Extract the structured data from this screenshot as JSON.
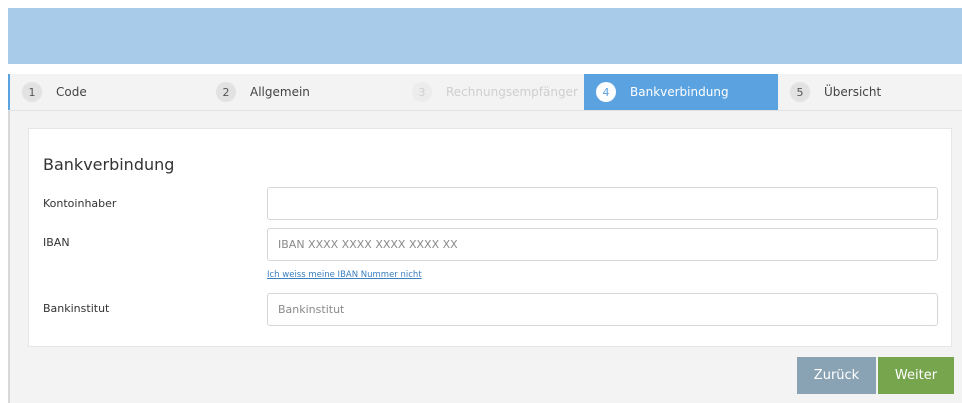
{
  "steps": [
    {
      "number": "1",
      "label": "Code",
      "state": "done"
    },
    {
      "number": "2",
      "label": "Allgemein",
      "state": "done"
    },
    {
      "number": "3",
      "label": "Rechnungsempfänger",
      "state": "disabled"
    },
    {
      "number": "4",
      "label": "Bankverbindung",
      "state": "active"
    },
    {
      "number": "5",
      "label": "Übersicht",
      "state": "pending"
    }
  ],
  "form": {
    "title": "Bankverbindung",
    "account_holder": {
      "label": "Kontoinhaber",
      "value": "",
      "placeholder": ""
    },
    "iban": {
      "label": "IBAN",
      "value": "",
      "placeholder": "IBAN XXXX XXXX XXXX XXXX XX"
    },
    "iban_help_link": "Ich weiss meine IBAN Nummer nicht",
    "bank": {
      "label": "Bankinstitut",
      "value": "",
      "placeholder": "Bankinstitut"
    }
  },
  "buttons": {
    "back": "Zurück",
    "next": "Weiter"
  },
  "colors": {
    "banner": "#a9cbea",
    "active_step": "#5aa2e0",
    "back_button": "#8aa3b4",
    "next_button": "#77a54e",
    "link": "#3a7fc1"
  }
}
